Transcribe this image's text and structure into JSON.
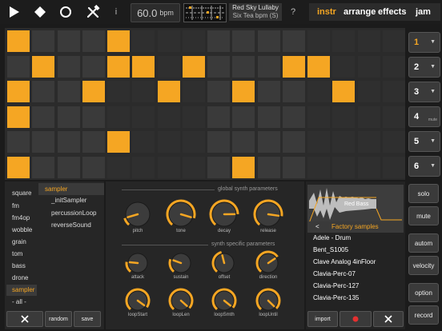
{
  "toolbar": {
    "info_label": "i",
    "bpm_value": "60.0",
    "bpm_unit": "bpm",
    "song_title": "Red Sky Lullaby",
    "song_subtitle": "Six Tea bpm (S)",
    "help_label": "?"
  },
  "nav": {
    "tabs": [
      {
        "label": "instr",
        "active": true
      },
      {
        "label": "arrange"
      },
      {
        "label": "effects"
      },
      {
        "label": "jam"
      }
    ]
  },
  "grid": {
    "rows": 6,
    "cols": 16,
    "active": [
      [
        0,
        4
      ],
      [
        1,
        4,
        5,
        7,
        11,
        12
      ],
      [
        0,
        3,
        6,
        9,
        13
      ],
      [
        0
      ],
      [
        4
      ],
      [
        0,
        9
      ]
    ]
  },
  "channels": [
    {
      "label": "1",
      "selected": true
    },
    {
      "label": "2"
    },
    {
      "label": "3"
    },
    {
      "label": "4",
      "note": "mute"
    },
    {
      "label": "5"
    },
    {
      "label": "6"
    }
  ],
  "side_buttons": {
    "solo": "solo",
    "mute": "mute",
    "autom": "autom",
    "velocity": "velocity",
    "option": "option",
    "record": "record"
  },
  "instrument_panel": {
    "header": "sampler",
    "categories": [
      "square",
      "fm",
      "fm4op",
      "wobble",
      "grain",
      "tom",
      "bass",
      "drone",
      "sampler",
      "- all -"
    ],
    "selected_category": "sampler",
    "presets": [
      "_initSampler",
      "percussionLoop",
      "reverseSound"
    ],
    "random_label": "random",
    "save_label": "save"
  },
  "params": {
    "global_title": "global synth parameters",
    "specific_title": "synth specific parameters",
    "global_knobs": [
      {
        "label": "pitch",
        "value": 0.12
      },
      {
        "label": "tone",
        "value": 0.88
      },
      {
        "label": "decay",
        "value": 0.82
      },
      {
        "label": "release",
        "value": 0.85
      }
    ],
    "specific_knobs_row1": [
      {
        "label": "attack",
        "value": 0.2
      },
      {
        "label": "sustain",
        "value": 0.25
      },
      {
        "label": "offset",
        "value": 0.45
      },
      {
        "label": "direction",
        "value": 0.7
      }
    ],
    "specific_knobs_row2": [
      {
        "label": "loopStart",
        "value": 0.95
      },
      {
        "label": "loopLen",
        "value": 0.97
      },
      {
        "label": "loopSmth",
        "value": 0.96
      },
      {
        "label": "loopUntil",
        "value": 0.98
      }
    ]
  },
  "samples": {
    "current_sample": "Red Bass",
    "back_label": "<",
    "header": "Factory samples",
    "items": [
      "Adele - Drum",
      "Bent_S1005",
      "Clave Analog 4inFloor",
      "Clavia-Perc-07",
      "Clavia-Perc-127",
      "Clavia-Perc-135"
    ],
    "import_label": "import"
  },
  "colors": {
    "accent": "#f5a623",
    "record": "#e53030",
    "cell_dark": "#3a3a3a",
    "cell_darker": "#2f2f2f"
  }
}
